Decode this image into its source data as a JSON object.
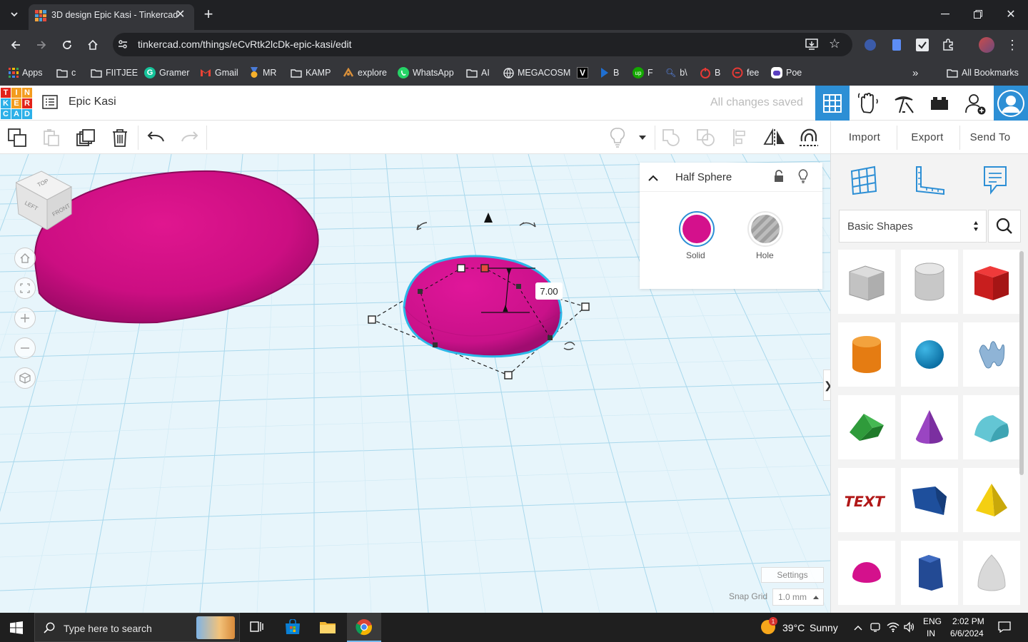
{
  "browser": {
    "tab_title": "3D design Epic Kasi - Tinkercad",
    "url": "tinkercad.com/things/eCvRtk2lcDk-epic-kasi/edit",
    "bookmarks": [
      {
        "label": "Apps",
        "icon": "apps-grid-icon"
      },
      {
        "label": "c",
        "icon": "folder-icon"
      },
      {
        "label": "FIITJEE",
        "icon": "folder-icon"
      },
      {
        "label": "Gramer",
        "icon": "grammarly-icon"
      },
      {
        "label": "Gmail",
        "icon": "gmail-icon"
      },
      {
        "label": "MR",
        "icon": "medal-icon"
      },
      {
        "label": "KAMP",
        "icon": "folder-icon"
      },
      {
        "label": "explore",
        "icon": "explore-icon"
      },
      {
        "label": "WhatsApp",
        "icon": "whatsapp-icon"
      },
      {
        "label": "AI",
        "icon": "folder-icon"
      },
      {
        "label": "MEGACOSM",
        "icon": "globe-icon"
      },
      {
        "label": "",
        "icon": "v-logo-icon"
      },
      {
        "label": "B",
        "icon": "b-logo-icon"
      },
      {
        "label": "F",
        "icon": "upwork-icon"
      },
      {
        "label": "b\\",
        "icon": "search-q-icon"
      },
      {
        "label": "B",
        "icon": "red-b-icon"
      },
      {
        "label": "fee",
        "icon": "fee-icon"
      },
      {
        "label": "Poe",
        "icon": "poe-icon"
      }
    ],
    "all_bookmarks": "All Bookmarks"
  },
  "app": {
    "logo_letters": [
      "T",
      "I",
      "N",
      "K",
      "E",
      "R",
      "C",
      "A",
      "D"
    ],
    "project_title": "Epic Kasi",
    "save_status": "All changes saved"
  },
  "toolbar": {
    "import": "Import",
    "export": "Export",
    "send_to": "Send To"
  },
  "viewcube": {
    "top": "TOP",
    "left": "LEFT",
    "front": "FRONT"
  },
  "workplane": {
    "dimension_value": "7.00",
    "settings_label": "Settings",
    "snap_grid_label": "Snap Grid",
    "snap_grid_value": "1.0 mm"
  },
  "inspector": {
    "title": "Half Sphere",
    "solid_label": "Solid",
    "hole_label": "Hole",
    "solid_color": "#d4118c"
  },
  "shapes_panel": {
    "category": "Basic Shapes",
    "shapes": [
      "box-hole",
      "cylinder-hole",
      "box",
      "cylinder",
      "sphere",
      "scribble",
      "roof",
      "cone",
      "round-roof",
      "text",
      "wedge",
      "pyramid",
      "half-sphere",
      "polygon",
      "paraboloid"
    ]
  },
  "taskbar": {
    "search_placeholder": "Type here to search",
    "weather_temp": "39°C",
    "weather_text": "Sunny",
    "lang_top": "ENG",
    "lang_bottom": "IN",
    "time": "2:02 PM",
    "date": "6/6/2024",
    "weather_badge": "1"
  }
}
